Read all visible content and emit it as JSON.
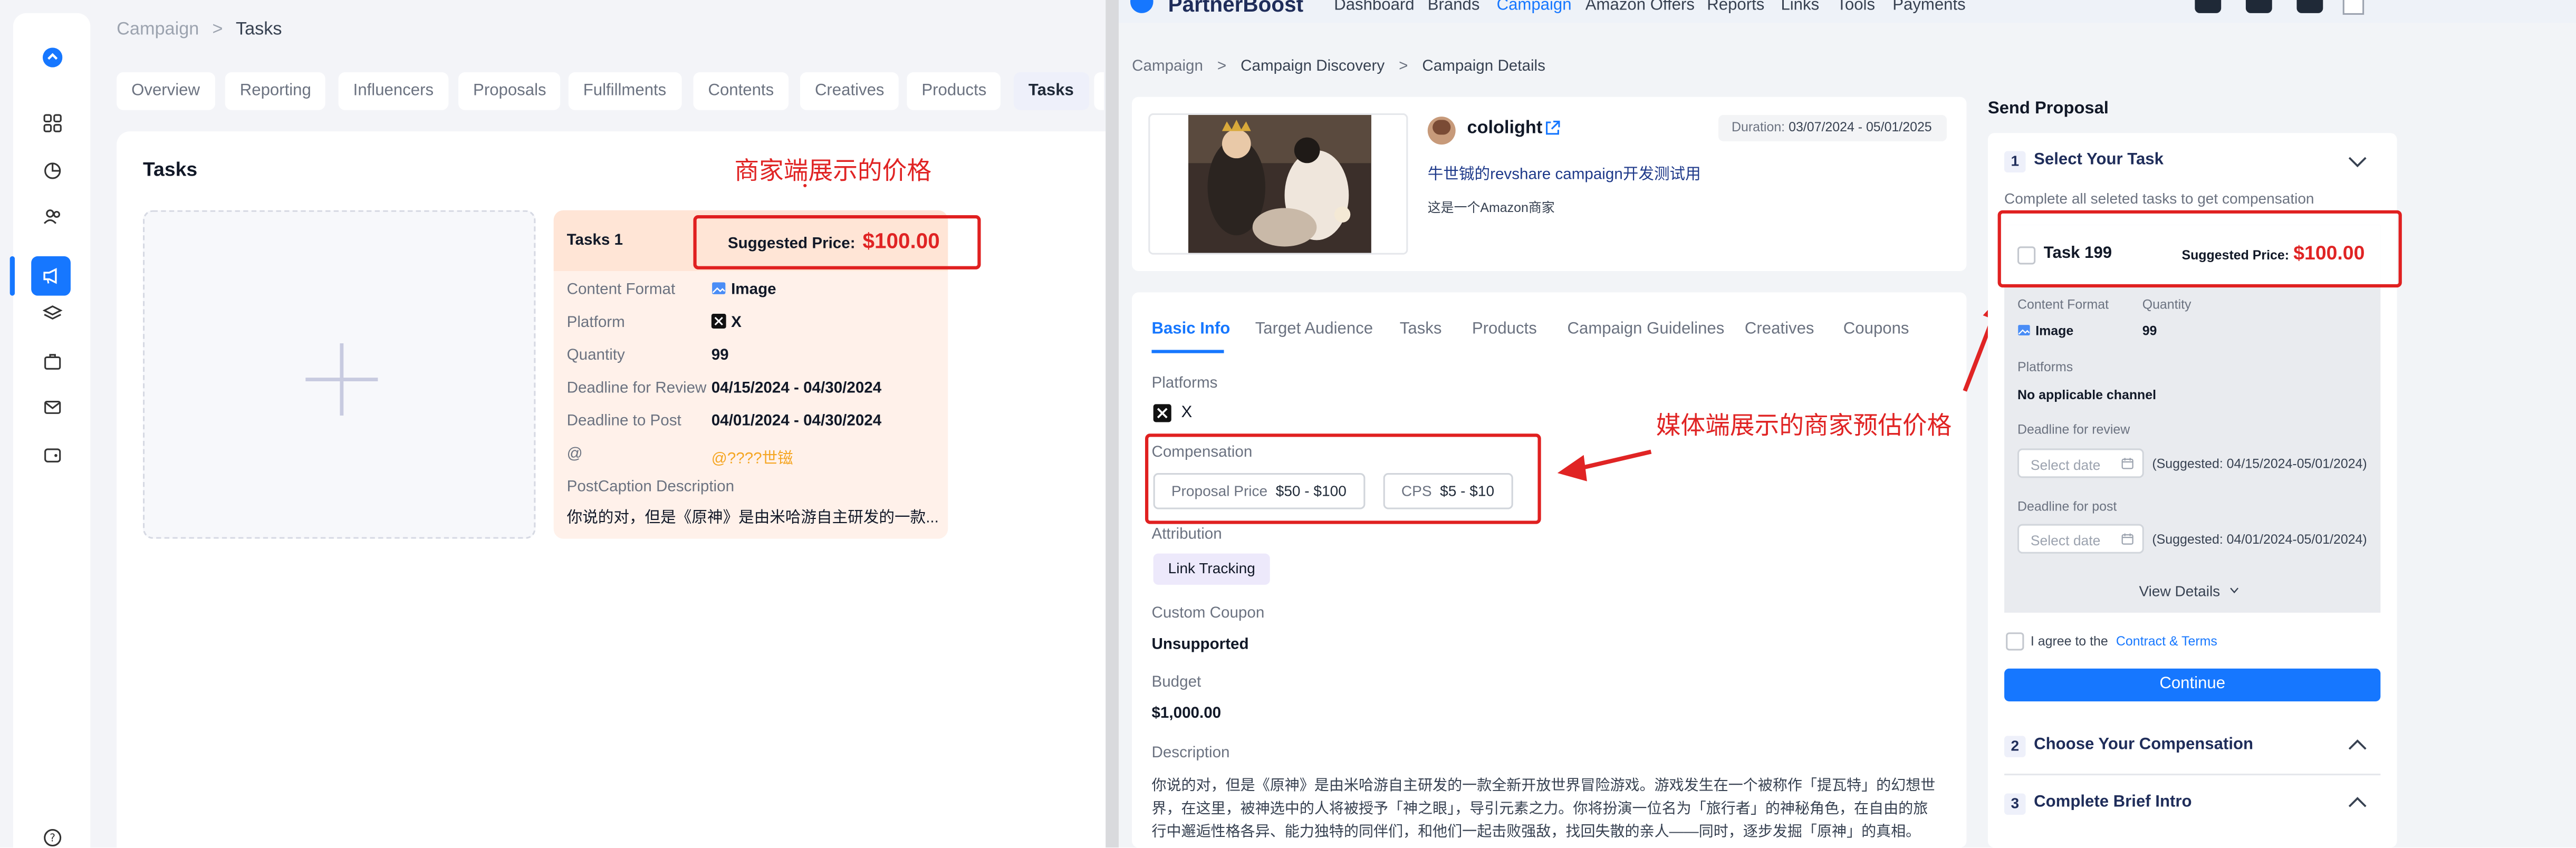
{
  "merchant": {
    "breadcrumb": [
      "Campaign",
      "Tasks"
    ],
    "tabs": [
      "Overview",
      "Reporting",
      "Influencers",
      "Proposals",
      "Fulfillments",
      "Contents",
      "Creatives",
      "Products",
      "Tasks"
    ],
    "active_tab": "Tasks",
    "section_title": "Tasks",
    "annotation": "商家端展示的价格",
    "task": {
      "name": "Tasks 1",
      "suggested_label": "Suggested Price:",
      "suggested_value": "$100.00",
      "rows": [
        {
          "label": "Content Format",
          "value": "Image",
          "icon": "image-icon"
        },
        {
          "label": "Platform",
          "value": "X",
          "icon": "x-logo-icon"
        },
        {
          "label": "Quantity",
          "value": "99"
        },
        {
          "label": "Deadline for Review",
          "value": "04/15/2024 - 04/30/2024"
        },
        {
          "label": "Deadline to Post",
          "value": "04/01/2024 - 04/30/2024"
        },
        {
          "label": "@",
          "value": "@????世镃"
        }
      ],
      "caption_label": "PostCaption Description",
      "caption_text": "你说的对，但是《原神》是由米哈游自主研发的一款..."
    },
    "sidebar_icons": [
      "logo-icon",
      "grid-icon",
      "pie-chart-icon",
      "users-icon",
      "campaign-icon",
      "layers-icon",
      "briefcase-icon",
      "mail-icon",
      "wallet-icon",
      "help-icon"
    ]
  },
  "creator": {
    "brand": "PartnerBoost",
    "nav": [
      "Dashboard",
      "Brands",
      "Campaign",
      "Amazon Offers",
      "Reports",
      "Links",
      "Tools",
      "Payments"
    ],
    "active_nav": "Campaign",
    "breadcrumb": [
      "Campaign",
      "Campaign Discovery",
      "Campaign Details"
    ],
    "campaign": {
      "brand_name": "cololight",
      "duration_label": "Duration:",
      "duration": "03/07/2024 - 05/01/2025",
      "title": "牛世铖的revshare campaign开发测试用",
      "subtitle": "这是一个Amazon商家"
    },
    "tabs": [
      "Basic Info",
      "Target Audience",
      "Tasks",
      "Products",
      "Campaign Guidelines",
      "Creatives",
      "Coupons"
    ],
    "active_tab": "Basic Info",
    "platforms_label": "Platforms",
    "platform": "X",
    "compensation_label": "Compensation",
    "compensation": [
      {
        "key": "Proposal Price",
        "value": "$50 - $100"
      },
      {
        "key": "CPS",
        "value": "$5 - $10"
      }
    ],
    "attribution_label": "Attribution",
    "attribution": "Link Tracking",
    "coupon_label": "Custom Coupon",
    "coupon": "Unsupported",
    "budget_label": "Budget",
    "budget": "$1,000.00",
    "description_label": "Description",
    "description_lines": [
      "你说的对，但是《原神》是由米哈游自主研发的一款全新开放世界冒险游戏。游戏发生在一个被称作「提瓦特」的幻想世",
      "界，在这里，被神选中的人将被授予「神之眼」，导引元素之力。你将扮演一位名为「旅行者」的神秘角色，在自由的旅",
      "行中邂逅性格各异、能力独特的同伴们，和他们一起击败强敌，找回失散的亲人——同时，逐步发掘「原神」的真相。"
    ],
    "annotation": "媒体端展示的商家预估价格",
    "proposal": {
      "title": "Send Proposal",
      "steps": [
        {
          "num": "1",
          "title": "Select Your Task"
        },
        {
          "num": "2",
          "title": "Choose Your Compensation"
        },
        {
          "num": "3",
          "title": "Complete Brief Intro"
        }
      ],
      "hint": "Complete all seleted tasks to get compensation",
      "task_name": "Task 199",
      "suggested_label": "Suggested Price:",
      "suggested_value": "$100.00",
      "content_format_label": "Content Format",
      "content_format": "Image",
      "quantity_label": "Quantity",
      "quantity": "99",
      "platforms_label": "Platforms",
      "platforms": "No applicable channel",
      "review_label": "Deadline for review",
      "review_placeholder": "Select date",
      "review_suggested": "(Suggested: 04/15/2024-05/01/2024)",
      "post_label": "Deadline for post",
      "post_placeholder": "Select date",
      "post_suggested": "(Suggested: 04/01/2024-05/01/2024)",
      "view_details": "View Details",
      "agree_prefix": "I agree to the",
      "agree_link": "Contract & Terms",
      "continue": "Continue"
    }
  },
  "colors": {
    "accent": "#1677ff",
    "annotation_red": "#e02020",
    "task_card_bg": "#fff1ea"
  }
}
